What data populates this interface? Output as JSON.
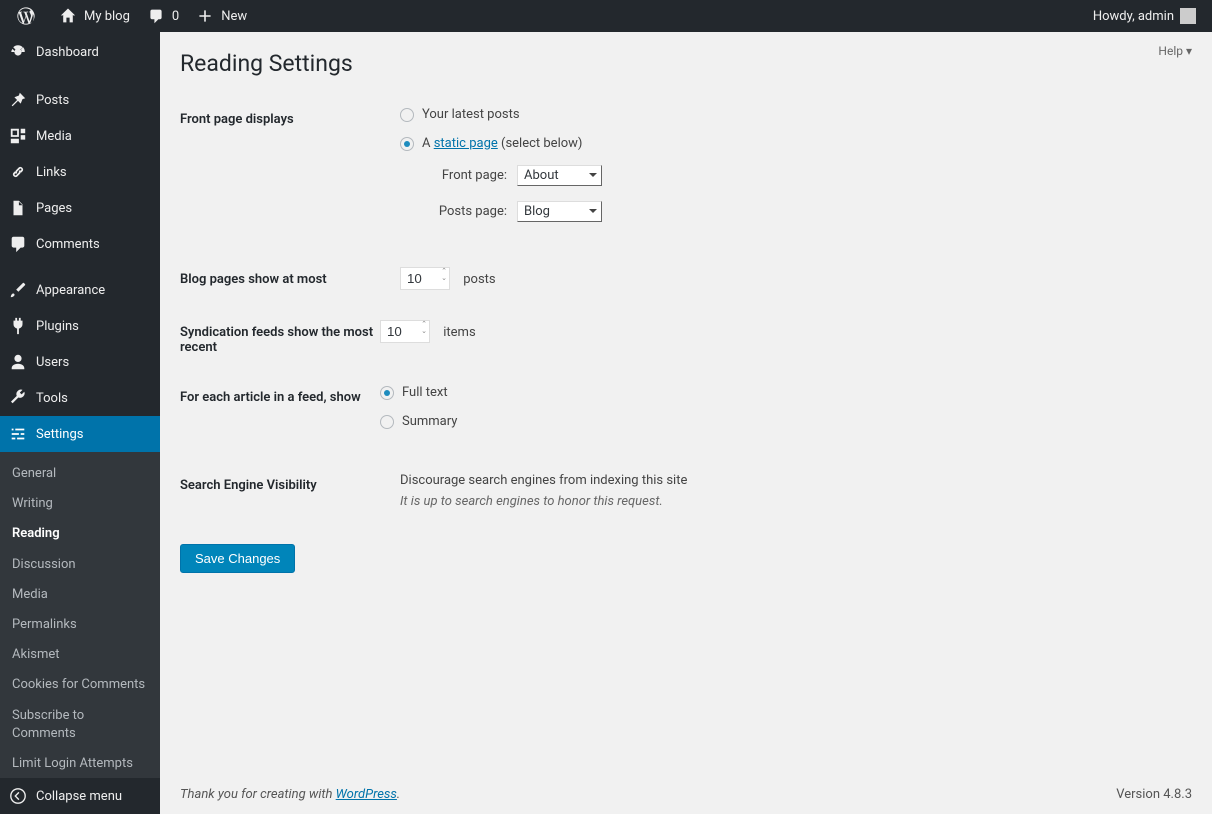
{
  "adminbar": {
    "site_name": "My blog",
    "comments_count": "0",
    "new_label": "New",
    "howdy": "Howdy, admin"
  },
  "sidebar": {
    "items": [
      {
        "label": "Dashboard"
      },
      {
        "label": "Posts"
      },
      {
        "label": "Media"
      },
      {
        "label": "Links"
      },
      {
        "label": "Pages"
      },
      {
        "label": "Comments"
      },
      {
        "label": "Appearance"
      },
      {
        "label": "Plugins"
      },
      {
        "label": "Users"
      },
      {
        "label": "Tools"
      },
      {
        "label": "Settings"
      }
    ],
    "submenu": [
      "General",
      "Writing",
      "Reading",
      "Discussion",
      "Media",
      "Permalinks",
      "Akismet",
      "Cookies for Comments",
      "Subscribe to Comments",
      "Limit Login Attempts"
    ],
    "collapse": "Collapse menu"
  },
  "page": {
    "help": "Help",
    "title": "Reading Settings",
    "front_page_displays": {
      "label": "Front page displays",
      "opt_latest": "Your latest posts",
      "opt_static_prefix": "A ",
      "opt_static_link": "static page",
      "opt_static_suffix": " (select below)",
      "front_page_label": "Front page:",
      "front_page_value": "About",
      "posts_page_label": "Posts page:",
      "posts_page_value": "Blog"
    },
    "blog_pages": {
      "label": "Blog pages show at most",
      "value": "10",
      "suffix": "posts"
    },
    "syndication": {
      "label": "Syndication feeds show the most recent",
      "value": "10",
      "suffix": "items"
    },
    "feed_article": {
      "label": "For each article in a feed, show",
      "opt_full": "Full text",
      "opt_summary": "Summary"
    },
    "search_visibility": {
      "label": "Search Engine Visibility",
      "checkbox_label": "Discourage search engines from indexing this site",
      "note": "It is up to search engines to honor this request."
    },
    "save_button": "Save Changes",
    "footer_prefix": "Thank you for creating with ",
    "footer_link": "WordPress",
    "footer_suffix": ".",
    "version": "Version 4.8.3"
  }
}
